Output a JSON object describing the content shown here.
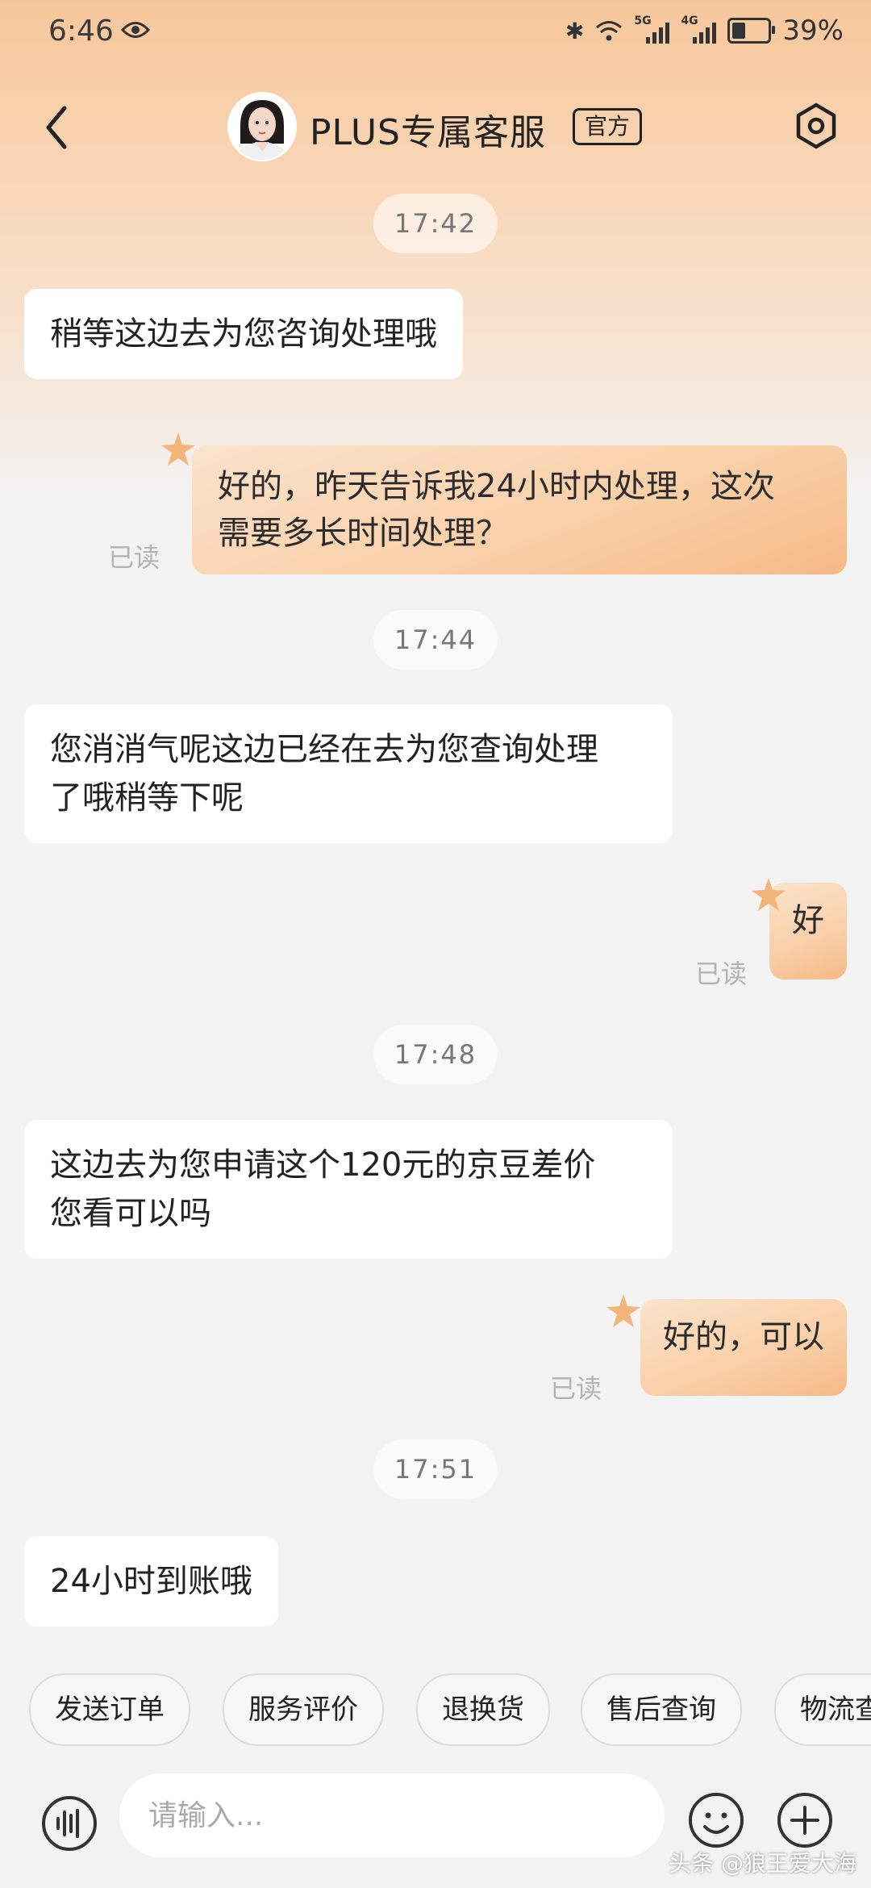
{
  "status_bar": {
    "time": "6:46",
    "signal_1_label": "5G",
    "signal_2_label": "4G",
    "battery_percent": "39%",
    "battery_level": 0.39
  },
  "header": {
    "title": "PLUS专属客服",
    "badge": "官方"
  },
  "messages": [
    {
      "type": "time",
      "text": "17:42"
    },
    {
      "type": "incoming",
      "text": "稍等这边去为您咨询处理哦"
    },
    {
      "type": "outgoing",
      "lines": [
        "好的，昨天告诉我24小时内处理，这次",
        "需要多长时间处理？"
      ],
      "status": "已读"
    },
    {
      "type": "time",
      "text": "17:44"
    },
    {
      "type": "incoming",
      "lines": [
        "您消消气呢这边已经在去为您查询处理",
        "了哦稍等下呢"
      ]
    },
    {
      "type": "outgoing",
      "text": "好",
      "status": "已读"
    },
    {
      "type": "time",
      "text": "17:48"
    },
    {
      "type": "incoming",
      "lines": [
        "这边去为您申请这个120元的京豆差价",
        "您看可以吗"
      ]
    },
    {
      "type": "outgoing",
      "text": "好的，可以",
      "status": "已读"
    },
    {
      "type": "time",
      "text": "17:51"
    },
    {
      "type": "incoming",
      "text": "24小时到账哦"
    }
  ],
  "quick_actions": [
    "发送订单",
    "服务评价",
    "退换货",
    "售后查询",
    "物流查"
  ],
  "input": {
    "placeholder": "请输入..."
  },
  "watermark": "头条 @狼王爱大海",
  "colors": {
    "accent_orange": "#f6b986",
    "header_gradient_top": "#f7c79c",
    "background": "#f3f3f3"
  }
}
